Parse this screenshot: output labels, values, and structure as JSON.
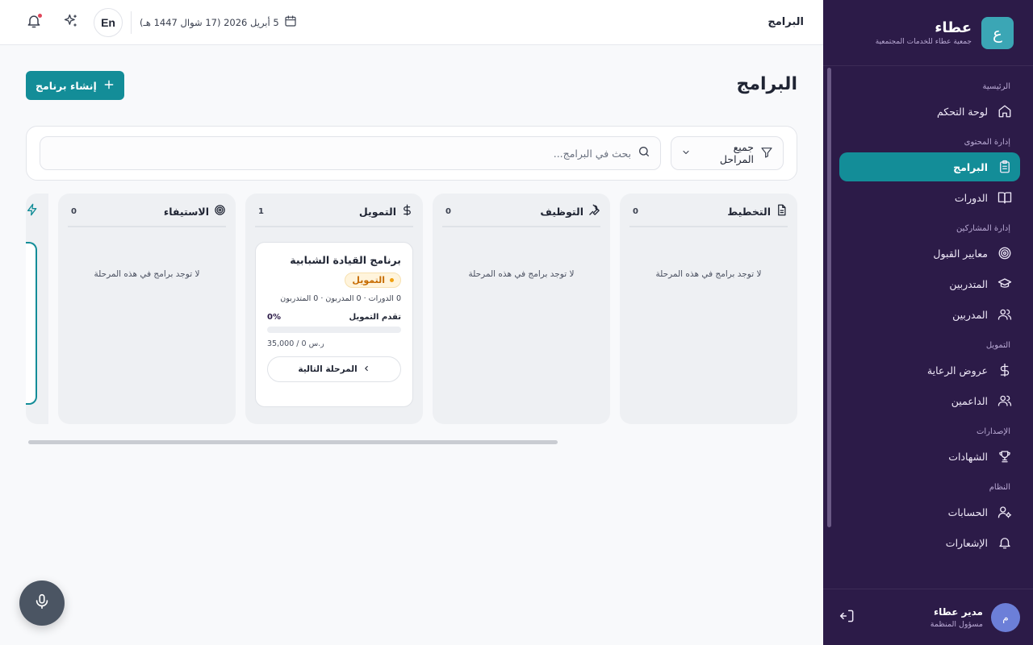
{
  "brand": {
    "name": "عطاء",
    "subtitle": "جمعية عطاء للخدمات المجتمعية",
    "logo_letter": "ع",
    "accent": "#3ba6b5"
  },
  "sidebar": {
    "sections": [
      {
        "title": "الرئيسية",
        "items": [
          {
            "label": "لوحة التحكم",
            "icon": "home-icon"
          }
        ]
      },
      {
        "title": "إدارة المحتوى",
        "items": [
          {
            "label": "البرامج",
            "icon": "clipboard-icon",
            "active": true
          },
          {
            "label": "الدورات",
            "icon": "book-icon"
          }
        ]
      },
      {
        "title": "إدارة المشاركين",
        "items": [
          {
            "label": "معايير القبول",
            "icon": "target-icon"
          },
          {
            "label": "المتدربين",
            "icon": "graduation-cap-icon"
          },
          {
            "label": "المدربين",
            "icon": "users-icon"
          }
        ]
      },
      {
        "title": "التمويل",
        "items": [
          {
            "label": "عروض الرعاية",
            "icon": "dollar-icon"
          },
          {
            "label": "الداعمين",
            "icon": "users-icon"
          }
        ]
      },
      {
        "title": "الإصدارات",
        "items": [
          {
            "label": "الشهادات",
            "icon": "trophy-icon"
          }
        ]
      },
      {
        "title": "النظام",
        "items": [
          {
            "label": "الحسابات",
            "icon": "user-cog-icon"
          },
          {
            "label": "الإشعارات",
            "icon": "bell-icon"
          }
        ]
      }
    ],
    "active_color": "#138d98"
  },
  "user": {
    "name": "مدير عطاء",
    "role": "مسؤول المنظمة",
    "initial": "م"
  },
  "topbar": {
    "title": "البرامج",
    "date": "5 أبريل 2026 (17 شوال 1447 هـ)",
    "lang": "En"
  },
  "page": {
    "title": "البرامج",
    "create_label": "إنشاء برنامج"
  },
  "filters": {
    "stage_label": "جميع المراحل",
    "search_placeholder": "بحث في البرامج..."
  },
  "columns": [
    {
      "title": "التخطيط",
      "icon": "document-icon",
      "count": "0",
      "empty": "لا توجد برامج في هذه المرحلة"
    },
    {
      "title": "التوظيف",
      "icon": "wrench-icon",
      "count": "0",
      "empty": "لا توجد برامج في هذه المرحلة"
    },
    {
      "title": "التمويل",
      "icon": "dollar-icon",
      "count": "1",
      "empty": ""
    },
    {
      "title": "الاستيفاء",
      "icon": "target-icon",
      "count": "0",
      "empty": "لا توجد برامج في هذه المرحلة"
    }
  ],
  "program_card": {
    "title": "برنامج القيادة الشبابية",
    "badge": "التمويل",
    "meta": "0 الدورات · 0 المدربون · 0 المتدربون",
    "progress_label": "تقدم التمويل",
    "progress_pct": "0%",
    "progress_value": 0,
    "amount": "ر.س 0 / 35,000",
    "next_label": "المرحلة التالية"
  }
}
